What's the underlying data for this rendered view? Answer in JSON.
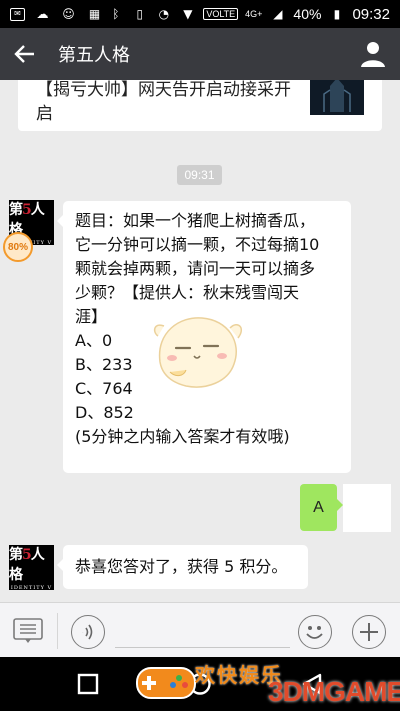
{
  "status_bar": {
    "network_label": "VOLTE",
    "signal_label": "4G+",
    "battery": "40%",
    "time": "09:32"
  },
  "header": {
    "title": "第五人格"
  },
  "chat": {
    "previous_card_text": "【揭亏大帅】网天告开启动接采开启",
    "timestamp": "09:31",
    "badge": "80%",
    "avatar_text": "第五人格",
    "avatar_subtext": "IDENTITY V",
    "question_lines": [
      "题目：如果一个猪爬上树摘香瓜，",
      "它一分钟可以摘一颗，不过每摘10",
      "颗就会掉两颗，请问一天可以摘多",
      "少颗？【提供人：秋末残雪闯天",
      "涯】",
      "A、0",
      "B、233",
      "C、764",
      "D、852",
      "(5分钟之内输入答案才有效哦)"
    ],
    "user_reply": "A",
    "result_text": "恭喜您答对了，获得 5 积分。"
  },
  "watermark": {
    "text": "欢快娱乐",
    "brand": "3DMGAME"
  },
  "colors": {
    "header_bg": "#393a3f",
    "chat_bg": "#ebebeb",
    "sent_bubble": "#9fe65f"
  }
}
